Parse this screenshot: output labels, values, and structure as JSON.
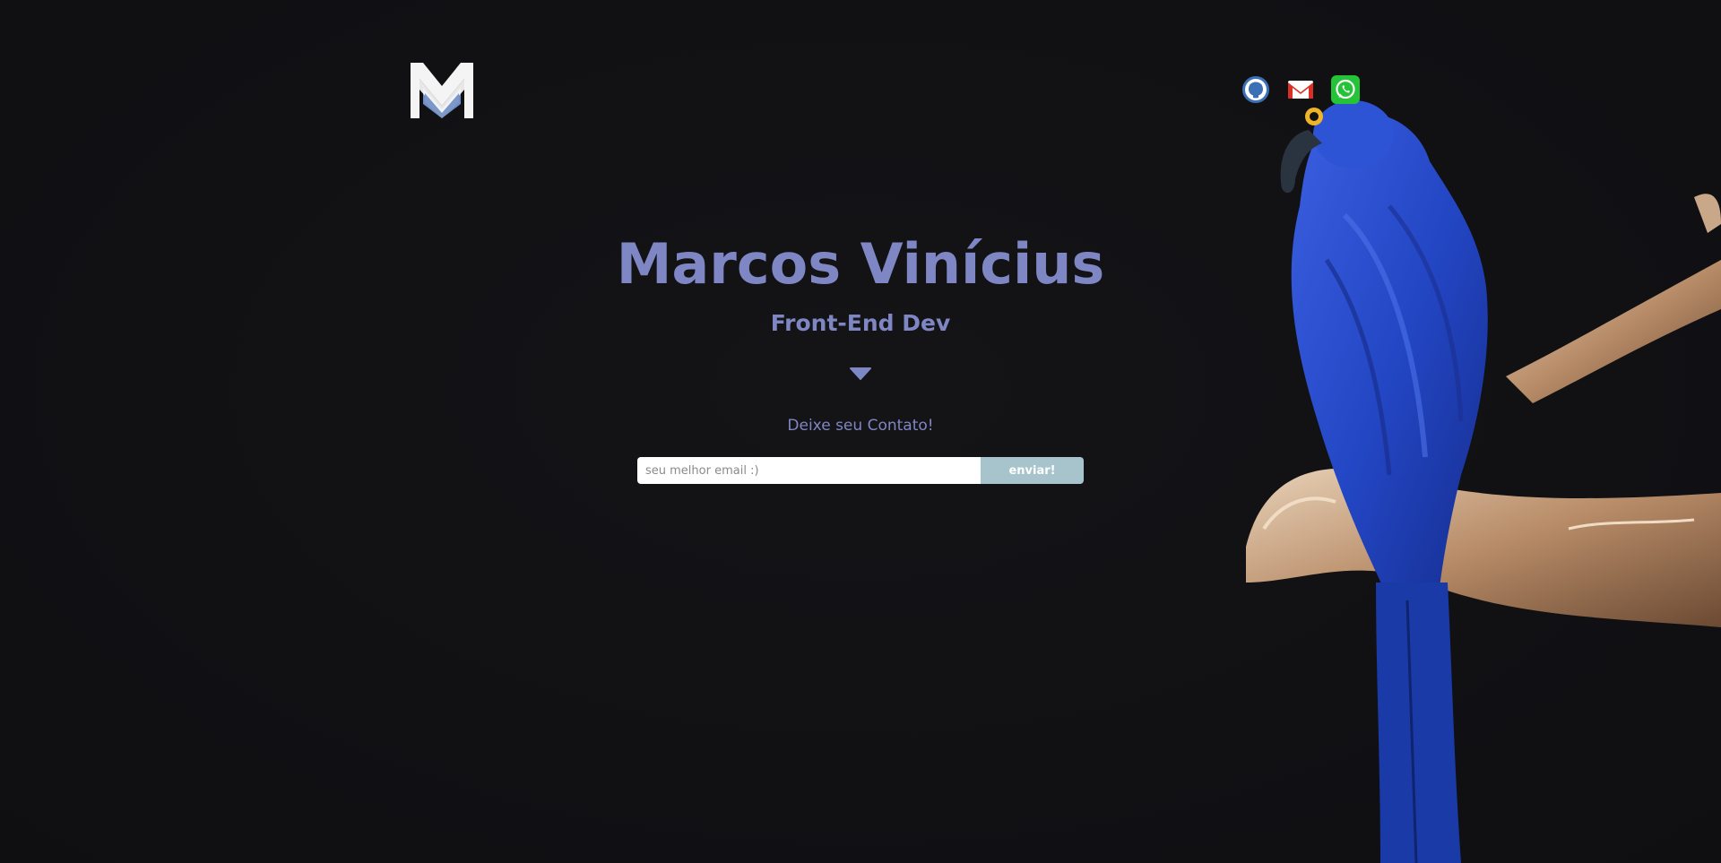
{
  "header": {
    "logo_icon": "m-monogram-logo",
    "socials": [
      {
        "name": "github-icon",
        "color": "#3b6fb6"
      },
      {
        "name": "gmail-icon",
        "color": "#d93025"
      },
      {
        "name": "whatsapp-icon",
        "color": "#25c337"
      }
    ]
  },
  "hero": {
    "name": "Marcos Vinícius",
    "role": "Front-End Dev",
    "scroll_icon": "caret-down-icon"
  },
  "contact": {
    "label": "Deixe seu Contato!",
    "email_placeholder": "seu melhor email :)",
    "email_value": "",
    "submit_label": "enviar!"
  },
  "colors": {
    "background": "#111114",
    "accent": "#7f86c4",
    "button": "#a7c4cc"
  },
  "background_image": "blue-macaw-on-branch"
}
